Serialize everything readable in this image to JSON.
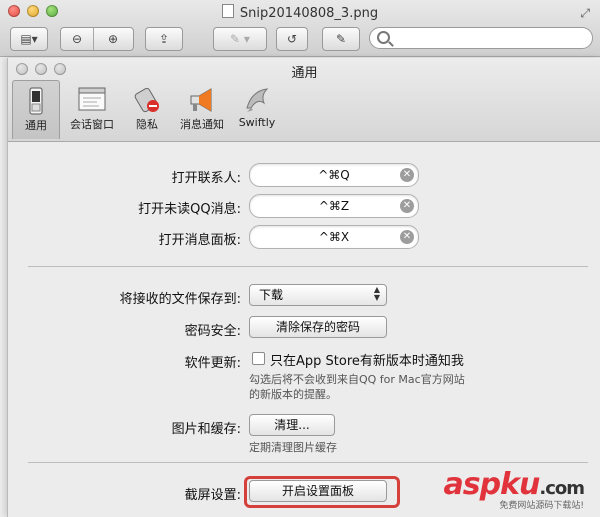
{
  "window": {
    "title": "Snip20140808_3.png"
  },
  "prefs": {
    "title": "通用",
    "tabs": [
      {
        "label": "通用",
        "icon": "switch-icon"
      },
      {
        "label": "会话窗口",
        "icon": "window-icon"
      },
      {
        "label": "隐私",
        "icon": "privacy-icon"
      },
      {
        "label": "消息通知",
        "icon": "megaphone-icon"
      },
      {
        "label": "Swiftly",
        "icon": "dolphin-icon"
      }
    ],
    "hotkeys": [
      {
        "label": "打开联系人:",
        "value": "^⌘Q"
      },
      {
        "label": "打开未读QQ消息:",
        "value": "^⌘Z"
      },
      {
        "label": "打开消息面板:",
        "value": "^⌘X"
      }
    ],
    "save_to": {
      "label": "将接收的文件保存到:",
      "value": "下载"
    },
    "password": {
      "label": "密码安全:",
      "button": "清除保存的密码"
    },
    "update": {
      "label": "软件更新:",
      "checkbox": "只在App Store有新版本时通知我",
      "checked": false,
      "hint_line1": "勾选后将不会收到来自QQ for Mac官方网站",
      "hint_line2": "的新版本的提醒。"
    },
    "cache": {
      "label": "图片和缓存:",
      "button": "清理...",
      "hint": "定期清理图片缓存"
    },
    "screenshot": {
      "label": "截屏设置:",
      "button": "开启设置面板"
    }
  },
  "watermark": {
    "brand": "aspku",
    "suffix": ".com",
    "sub": "免费网站源码下载站!"
  },
  "colors": {
    "highlight": "#d6403b",
    "watermark": "#e1333c"
  }
}
